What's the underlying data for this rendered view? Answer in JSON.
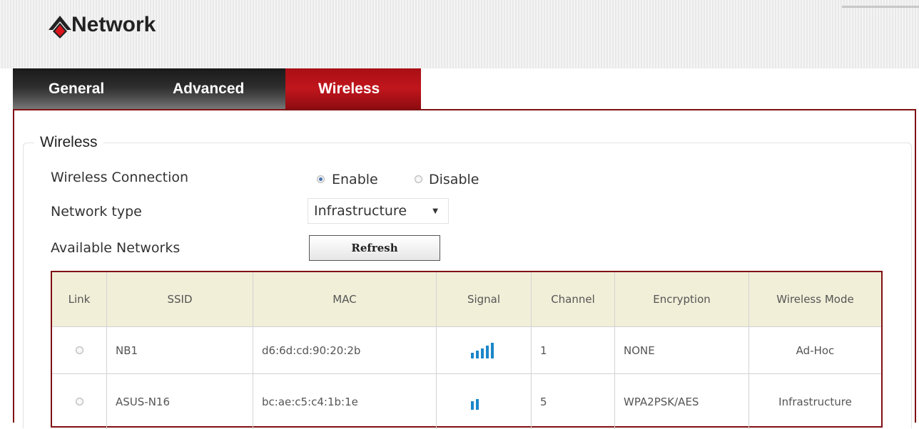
{
  "app": {
    "title": "Network"
  },
  "tabs": [
    {
      "label": "General",
      "active": false
    },
    {
      "label": "Advanced",
      "active": false
    },
    {
      "label": "Wireless",
      "active": true
    }
  ],
  "section": {
    "legend": "Wireless"
  },
  "form": {
    "wireless_connection": {
      "label": "Wireless Connection",
      "options": [
        "Enable",
        "Disable"
      ],
      "selected": "Enable"
    },
    "network_type": {
      "label": "Network type",
      "value": "Infrastructure"
    },
    "available_networks": {
      "label": "Available Networks",
      "button": "Refresh"
    }
  },
  "table": {
    "columns": [
      "Link",
      "SSID",
      "MAC",
      "Signal",
      "Channel",
      "Encryption",
      "Wireless Mode"
    ],
    "rows": [
      {
        "ssid": "NB1",
        "mac": "d6:6d:cd:90:20:2b",
        "signal_bars": 5,
        "channel": "1",
        "encryption": "NONE",
        "mode": "Ad-Hoc"
      },
      {
        "ssid": "ASUS-N16",
        "mac": "bc:ae:c5:c4:1b:1e",
        "signal_bars": 2,
        "channel": "5",
        "encryption": "WPA2PSK/AES",
        "mode": "Infrastructure"
      }
    ]
  },
  "colors": {
    "accent_red": "#c1161d",
    "frame_border": "#7f1013",
    "header_cell_bg": "#f1efd8",
    "signal_blue": "#1b86c8"
  },
  "icons": {
    "logo": "network-logo-icon",
    "dropdown": "caret-down-icon",
    "signal": "signal-strength-icon"
  }
}
